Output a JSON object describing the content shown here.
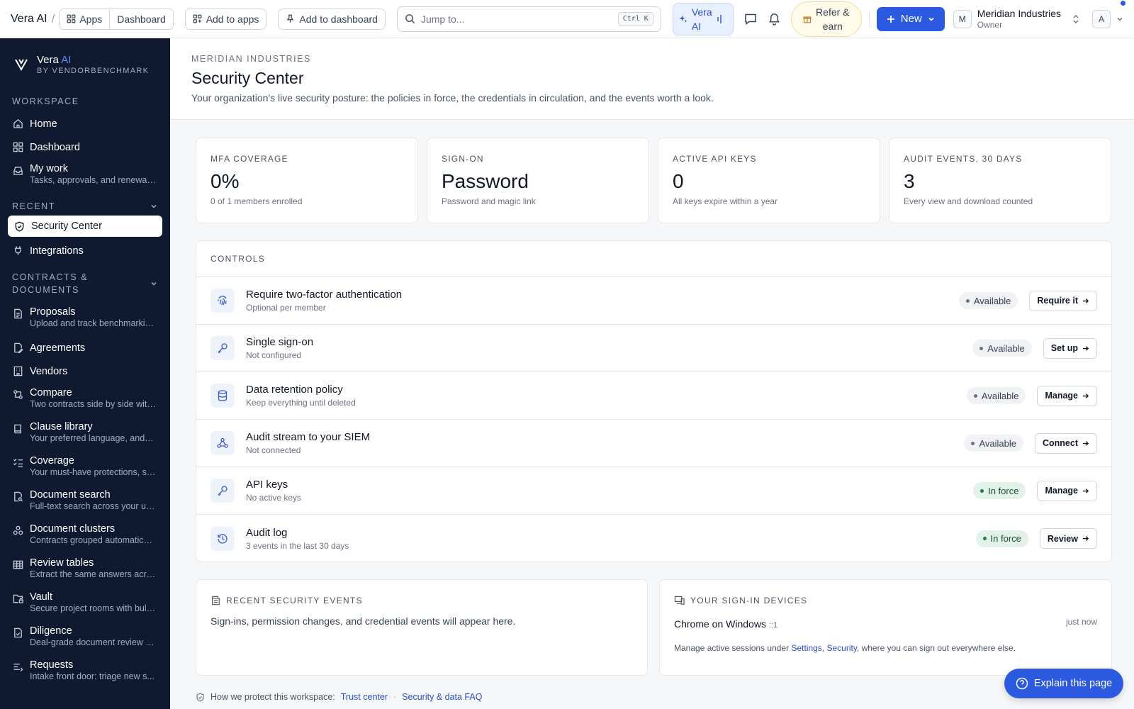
{
  "topbar": {
    "brand": "Vera AI",
    "apps_label": "Apps",
    "dashboard_label": "Dashboard",
    "add_to_apps": "Add to apps",
    "add_to_dashboard": "Add to dashboard",
    "search_placeholder": "Jump to...",
    "search_shortcut": "Ctrl K",
    "vera_line1": "Vera",
    "vera_line2": "AI",
    "refer_line1": "Refer &",
    "refer_line2": "earn",
    "new_label": "New",
    "org_initial": "M",
    "org_name": "Meridian Industries",
    "org_role": "Owner",
    "user_initial": "A"
  },
  "sidebar": {
    "logo_name": "Vera",
    "logo_ai": "AI",
    "logo_sub": "BY VENDORBENCHMARK",
    "workspace_label": "WORKSPACE",
    "workspace": [
      {
        "label": "Home"
      },
      {
        "label": "Dashboard"
      },
      {
        "label": "My work",
        "sub": "Tasks, approvals, and renewals ..."
      }
    ],
    "recent_label": "RECENT",
    "recent": [
      {
        "label": "Security Center"
      },
      {
        "label": "Integrations"
      }
    ],
    "contracts_label_1": "CONTRACTS &",
    "contracts_label_2": "DOCUMENTS",
    "contracts": [
      {
        "label": "Proposals",
        "sub": "Upload and track benchmarkin..."
      },
      {
        "label": "Agreements"
      },
      {
        "label": "Vendors"
      },
      {
        "label": "Compare",
        "sub": "Two contracts side by side with..."
      },
      {
        "label": "Clause library",
        "sub": "Your preferred language, and h..."
      },
      {
        "label": "Coverage",
        "sub": "Your must-have protections, sw..."
      },
      {
        "label": "Document search",
        "sub": "Full-text search across your upl..."
      },
      {
        "label": "Document clusters",
        "sub": "Contracts grouped automatical..."
      },
      {
        "label": "Review tables",
        "sub": "Extract the same answers acros..."
      },
      {
        "label": "Vault",
        "sub": "Secure project rooms with bulk..."
      },
      {
        "label": "Diligence",
        "sub": "Deal-grade document review w..."
      },
      {
        "label": "Requests",
        "sub": "Intake front door: triage new s..."
      }
    ]
  },
  "header": {
    "breadcrumb": "MERIDIAN INDUSTRIES",
    "title": "Security Center",
    "description": "Your organization's live security posture: the policies in force, the credentials in circulation, and the events worth a look."
  },
  "kpis": [
    {
      "label": "MFA COVERAGE",
      "value": "0%",
      "sub": "0 of 1 members enrolled"
    },
    {
      "label": "SIGN-ON",
      "value": "Password",
      "sub": "Password and magic link"
    },
    {
      "label": "ACTIVE API KEYS",
      "value": "0",
      "sub": "All keys expire within a year"
    },
    {
      "label": "AUDIT EVENTS, 30 DAYS",
      "value": "3",
      "sub": "Every view and download counted"
    }
  ],
  "controls": {
    "title": "CONTROLS",
    "rows": [
      {
        "title": "Require two-factor authentication",
        "sub": "Optional per member",
        "status": "Available",
        "action": "Require it",
        "icon": "fingerprint-icon"
      },
      {
        "title": "Single sign-on",
        "sub": "Not configured",
        "status": "Available",
        "action": "Set up",
        "icon": "key-icon"
      },
      {
        "title": "Data retention policy",
        "sub": "Keep everything until deleted",
        "status": "Available",
        "action": "Manage",
        "icon": "database-icon"
      },
      {
        "title": "Audit stream to your SIEM",
        "sub": "Not connected",
        "status": "Available",
        "action": "Connect",
        "icon": "webhook-icon"
      },
      {
        "title": "API keys",
        "sub": "No active keys",
        "status": "In force",
        "action": "Manage",
        "icon": "key-icon"
      },
      {
        "title": "Audit log",
        "sub": "3 events in the last 30 days",
        "status": "In force",
        "action": "Review",
        "icon": "history-icon"
      }
    ]
  },
  "events": {
    "title": "RECENT SECURITY EVENTS",
    "empty": "Sign-ins, permission changes, and credential events will appear here."
  },
  "devices": {
    "title": "YOUR SIGN-IN DEVICES",
    "device_name": "Chrome on Windows",
    "device_ip": "::1",
    "device_time": "just now",
    "note_prefix": "Manage active sessions under",
    "note_link": "Settings, Security",
    "note_suffix": ", where you can sign out everywhere else."
  },
  "footer": {
    "prefix": "How we protect this workspace:",
    "trust": "Trust center",
    "sep": "·",
    "faq": "Security & data FAQ"
  },
  "explain_label": "Explain this page",
  "colors": {
    "accent": "#2b59e0",
    "sidebar": "#0f1a31",
    "success": "#1f7a45"
  }
}
